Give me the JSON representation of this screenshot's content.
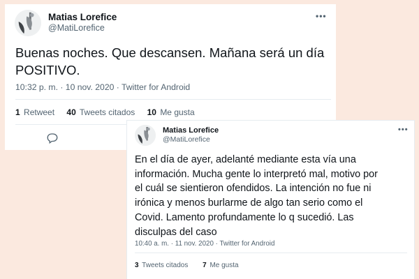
{
  "tweets": [
    {
      "author_name": "Matias Lorefice",
      "author_handle": "@MatiLorefice",
      "text": "Buenas noches. Que descansen. Mañana será un día\nPOSITIVO.",
      "meta": "10:32 p. m. · 10 nov. 2020 · Twitter for Android",
      "stats": [
        {
          "count": "1",
          "label": "Retweet"
        },
        {
          "count": "40",
          "label": "Tweets citados"
        },
        {
          "count": "10",
          "label": "Me gusta"
        }
      ],
      "more_icon": "ellipsis-icon",
      "reply_icon": "reply-icon"
    },
    {
      "author_name": "Matias Lorefice",
      "author_handle": "@MatiLorefice",
      "text": "En el día de ayer, adelanté mediante esta vía una\ninformación. Mucha gente lo interpretó mal, motivo por\nel cuál se sientieron ofendidos. La intención no fue ni\nirónica y menos burlarme de algo tan serio como el\nCovid. Lamento profundamente lo q sucedió. Las\ndisculpas del caso",
      "meta": "10:40 a. m. · 11 nov. 2020 · Twitter for Android",
      "stats": [
        {
          "count": "3",
          "label": "Tweets citados"
        },
        {
          "count": "7",
          "label": "Me gusta"
        }
      ],
      "more_icon": "ellipsis-icon"
    }
  ],
  "colors": {
    "background": "#fbe9df",
    "card": "#ffffff",
    "secondary_text": "#536471",
    "divider": "#e6ecf0"
  }
}
